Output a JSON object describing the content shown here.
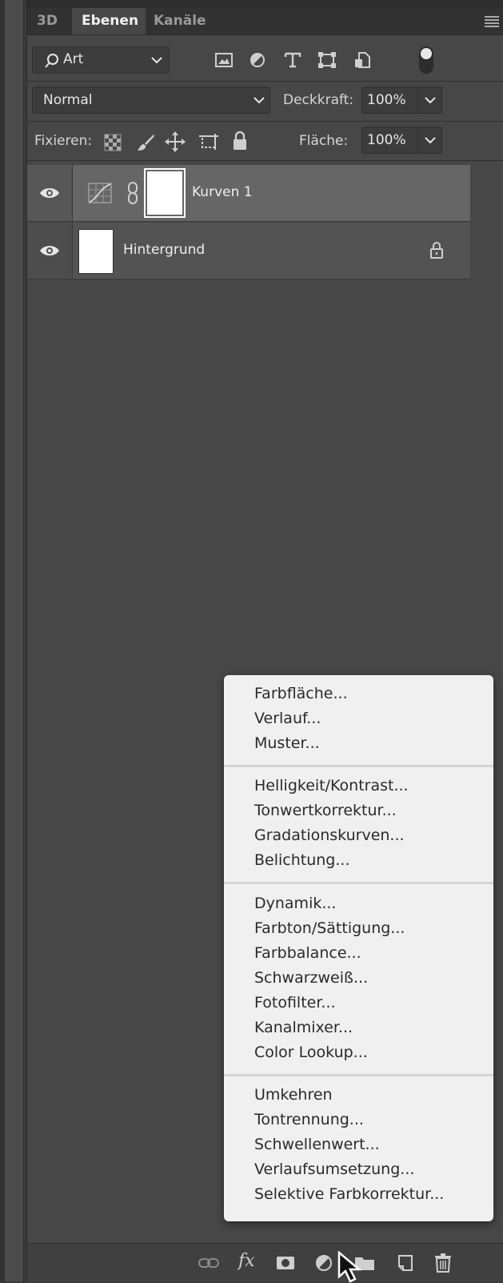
{
  "tabs": [
    {
      "label": "3D",
      "active": false
    },
    {
      "label": "Ebenen",
      "active": true
    },
    {
      "label": "Kanäle",
      "active": false
    }
  ],
  "filter": {
    "label": "Art",
    "icons": [
      "image-filter-icon",
      "adjustment-filter-icon",
      "type-filter-icon",
      "shape-filter-icon",
      "smart-object-filter-icon"
    ],
    "toggle_on": true
  },
  "blend": {
    "mode": "Normal",
    "opacity_label": "Deckkraft:",
    "opacity_value": "100%"
  },
  "lock": {
    "label": "Fixieren:",
    "fill_label": "Fläche:",
    "fill_value": "100%"
  },
  "layers": [
    {
      "name": "Kurven 1",
      "selected": true,
      "type": "curves-adjustment",
      "visible": true
    },
    {
      "name": "Hintergrund",
      "selected": false,
      "type": "background",
      "visible": true,
      "locked": true
    }
  ],
  "menu": {
    "groups": [
      [
        "Farbfläche...",
        "Verlauf...",
        "Muster..."
      ],
      [
        "Helligkeit/Kontrast...",
        "Tonwertkorrektur...",
        "Gradationskurven...",
        "Belichtung..."
      ],
      [
        "Dynamik...",
        "Farbton/Sättigung...",
        "Farbbalance...",
        "Schwarzweiß...",
        "Fotofilter...",
        "Kanalmixer...",
        "Color Lookup..."
      ],
      [
        "Umkehren",
        "Tontrennung...",
        "Schwellenwert...",
        "Verlaufsumsetzung...",
        "Selektive Farbkorrektur..."
      ]
    ]
  },
  "footer": {
    "icons": [
      "link-layers-icon",
      "fx-icon",
      "layer-mask-icon",
      "adjustment-layer-icon",
      "group-folder-icon",
      "new-layer-icon",
      "trash-icon"
    ],
    "fx_label": "fx"
  },
  "colors": {
    "panel": "#474747",
    "selected_layer": "#666666",
    "menu_bg": "#f0f0f0"
  }
}
